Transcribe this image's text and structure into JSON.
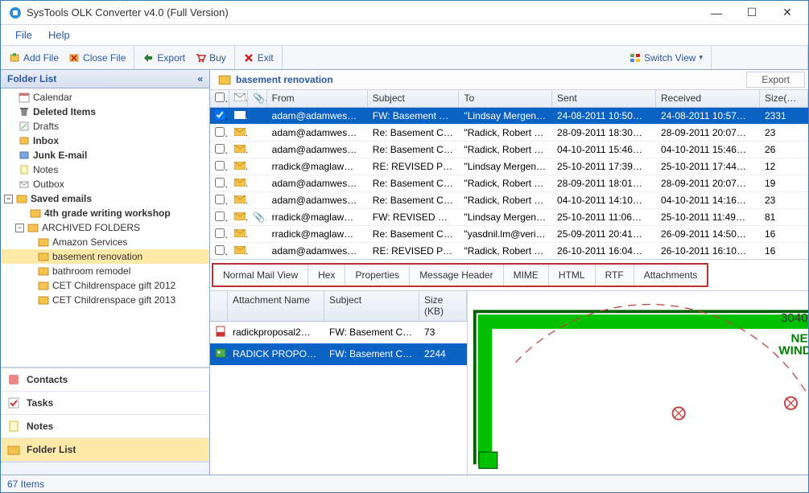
{
  "window": {
    "title": "SysTools OLK Converter v4.0 (Full Version)"
  },
  "menubar": {
    "file": "File",
    "help": "Help"
  },
  "toolbar": {
    "add_file": "Add File",
    "close_file": "Close File",
    "export": "Export",
    "buy": "Buy",
    "exit": "Exit",
    "switch_view": "Switch View"
  },
  "left": {
    "header": "Folder List",
    "tree": {
      "calendar": "Calendar",
      "deleted": "Deleted Items",
      "drafts": "Drafts",
      "inbox": "Inbox",
      "junk": "Junk E-mail",
      "notes": "Notes",
      "outbox": "Outbox",
      "saved": "Saved emails",
      "writing_workshop": "4th grade writing workshop",
      "archived": "ARCHIVED FOLDERS",
      "amazon": "Amazon Services",
      "basement": "basement renovation",
      "bathroom": "bathroom remodel",
      "cet2012": "CET Childrenspace gift 2012",
      "cet2013": "CET Childrenspace gift 2013"
    },
    "nav": {
      "contacts": "Contacts",
      "tasks": "Tasks",
      "notes": "Notes",
      "folder_list": "Folder List"
    }
  },
  "right": {
    "breadcrumb": "basement renovation",
    "exportlabel": "Export",
    "columns": {
      "from": "From",
      "subject": "Subject",
      "to": "To",
      "sent": "Sent",
      "received": "Received",
      "size": "Size(KB)"
    },
    "rows": [
      {
        "from": "adam@adamwes…",
        "subject": "FW: Basement C…",
        "to": "\"Lindsay Mergen…",
        "sent": "24-08-2011 10:50…",
        "received": "24-08-2011 10:57…",
        "size": "2331",
        "selected": true,
        "checked": true,
        "att": false
      },
      {
        "from": "adam@adamwes…",
        "subject": "Re: Basement Co…",
        "to": "\"Radick, Robert …",
        "sent": "28-09-2011 18:30…",
        "received": "28-09-2011 20:07…",
        "size": "23",
        "selected": false,
        "att": false
      },
      {
        "from": "adam@adamwes…",
        "subject": "Re: Basement Co…",
        "to": "\"Radick, Robert …",
        "sent": "04-10-2011 15:46…",
        "received": "04-10-2011 15:46…",
        "size": "26",
        "selected": false,
        "att": false
      },
      {
        "from": "rradick@maglaw…",
        "subject": "RE: REVISED PR…",
        "to": "\"Lindsay Mergen…",
        "sent": "25-10-2011 17:39…",
        "received": "25-10-2011 17:44…",
        "size": "12",
        "selected": false,
        "att": false
      },
      {
        "from": "adam@adamwes…",
        "subject": "Re: Basement Co…",
        "to": "\"Radick, Robert …",
        "sent": "28-09-2011 18:01…",
        "received": "28-09-2011 20:07…",
        "size": "19",
        "selected": false,
        "att": false
      },
      {
        "from": "adam@adamwes…",
        "subject": "Re: Basement Co…",
        "to": "\"Radick, Robert …",
        "sent": "04-10-2011 14:10…",
        "received": "04-10-2011 14:16…",
        "size": "23",
        "selected": false,
        "att": false
      },
      {
        "from": "rradick@maglaw…",
        "subject": "FW: REVISED PR…",
        "to": "\"Lindsay Mergen…",
        "sent": "25-10-2011 11:06…",
        "received": "25-10-2011 11:49…",
        "size": "81",
        "selected": false,
        "att": true
      },
      {
        "from": "rradick@maglaw…",
        "subject": "Re: Basement Co…",
        "to": "\"yasdnil.lm@veri…",
        "sent": "25-09-2011 20:41…",
        "received": "26-09-2011 14:50…",
        "size": "16",
        "selected": false,
        "att": false
      },
      {
        "from": "adam@adamwes…",
        "subject": "RE: REVISED PR…",
        "to": "\"Radick, Robert …",
        "sent": "26-10-2011 16:04…",
        "received": "26-10-2011 16:10…",
        "size": "16",
        "selected": false,
        "att": false
      }
    ],
    "tabs": {
      "normal": "Normal Mail View",
      "hex": "Hex",
      "properties": "Properties",
      "header": "Message Header",
      "mime": "MIME",
      "html": "HTML",
      "rtf": "RTF",
      "attachments": "Attachments"
    },
    "attach": {
      "columns": {
        "name": "Attachment Name",
        "subject": "Subject",
        "size": "Size (KB)"
      },
      "rows": [
        {
          "name": "radickproposal2…",
          "subject": "FW: Basement C…",
          "size": "73",
          "selected": false,
          "type": "pdf"
        },
        {
          "name": "RADICK PROPO…",
          "subject": "FW: Basement C…",
          "size": "2244",
          "selected": true,
          "type": "img"
        }
      ]
    },
    "preview": {
      "new_window": "NEW WINDOW",
      "dim": "3040"
    }
  },
  "status": {
    "items": "67 Items"
  }
}
